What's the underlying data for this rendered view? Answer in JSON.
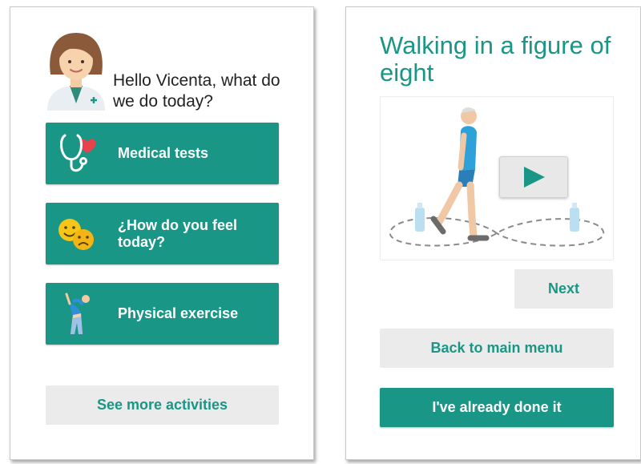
{
  "home": {
    "greeting": "Hello Vicenta, what do we do today?",
    "menu": [
      {
        "label": "Medical tests",
        "icon": "stethoscope-heart-icon"
      },
      {
        "label": "¿How do you feel today?",
        "icon": "happy-sad-faces-icon"
      },
      {
        "label": "Physical exercise",
        "icon": "stretching-person-icon"
      }
    ],
    "more_label": "See more activities"
  },
  "exercise": {
    "title": "Walking in a figure of eight",
    "video_icon": "play-icon",
    "next_label": "Next",
    "back_label": "Back to main menu",
    "done_label": "I've already done it"
  },
  "colors": {
    "primary": "#199685",
    "secondary_bg": "#ebebeb",
    "heart": "#e8424d",
    "emoji": "#f5c518"
  }
}
